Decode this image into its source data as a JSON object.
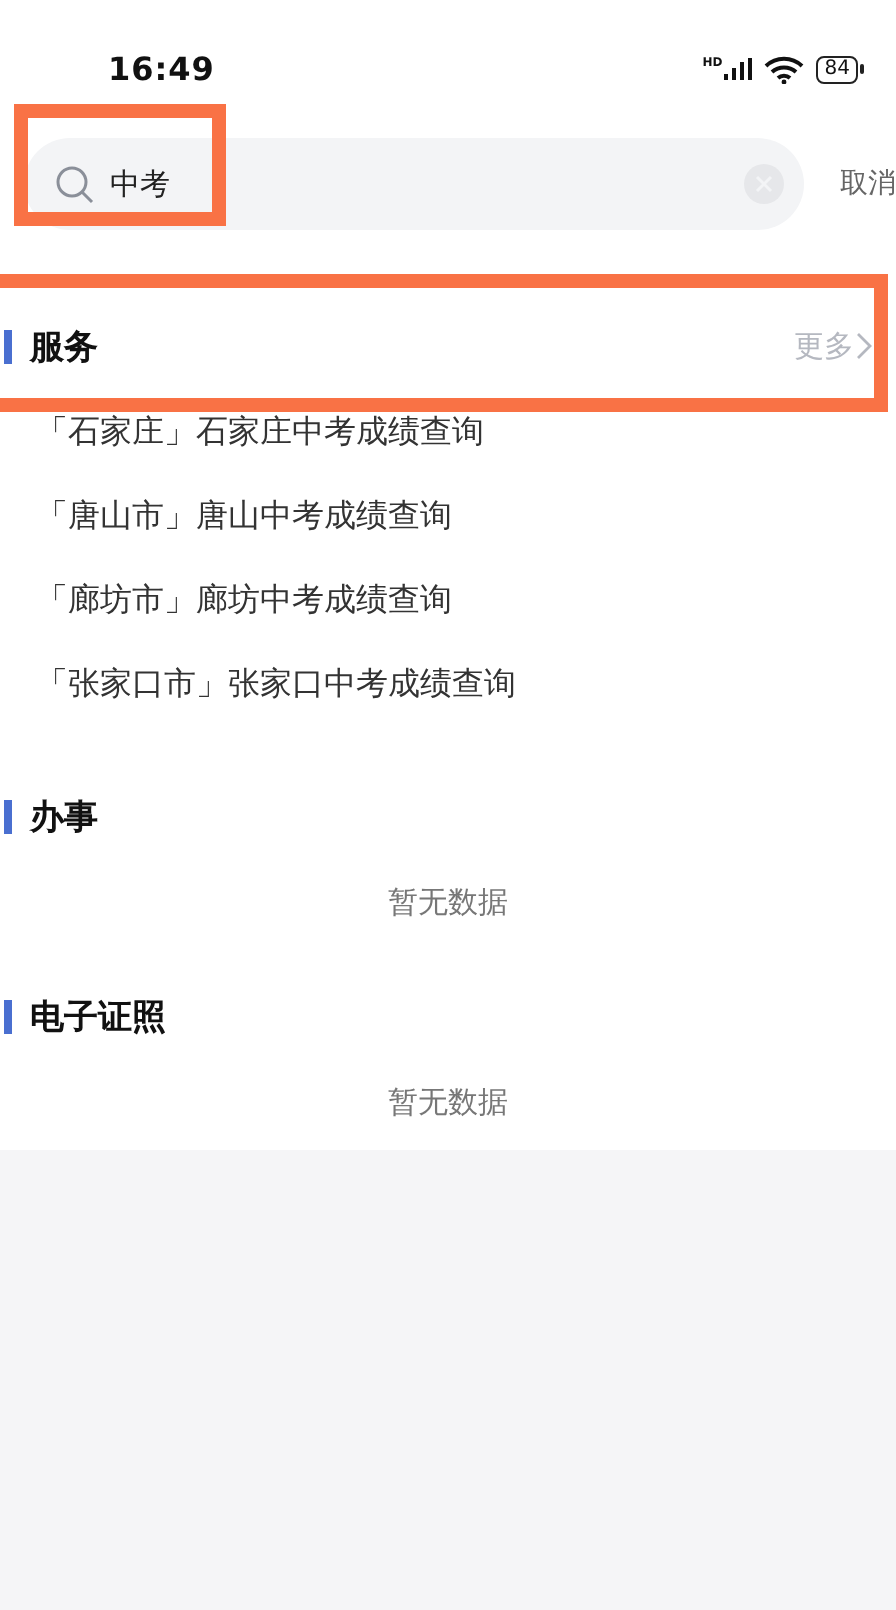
{
  "status_bar": {
    "time": "16:49",
    "network": "HD",
    "battery": "84"
  },
  "search": {
    "value": "中考",
    "cancel": "取消"
  },
  "sections": [
    {
      "title": "服务",
      "more": "更多",
      "items": [
        "「石家庄」石家庄中考成绩查询",
        "「唐山市」唐山中考成绩查询",
        "「廊坊市」廊坊中考成绩查询",
        "「张家口市」张家口中考成绩查询"
      ]
    },
    {
      "title": "办事",
      "empty": "暂无数据"
    },
    {
      "title": "电子证照",
      "empty": "暂无数据"
    }
  ]
}
